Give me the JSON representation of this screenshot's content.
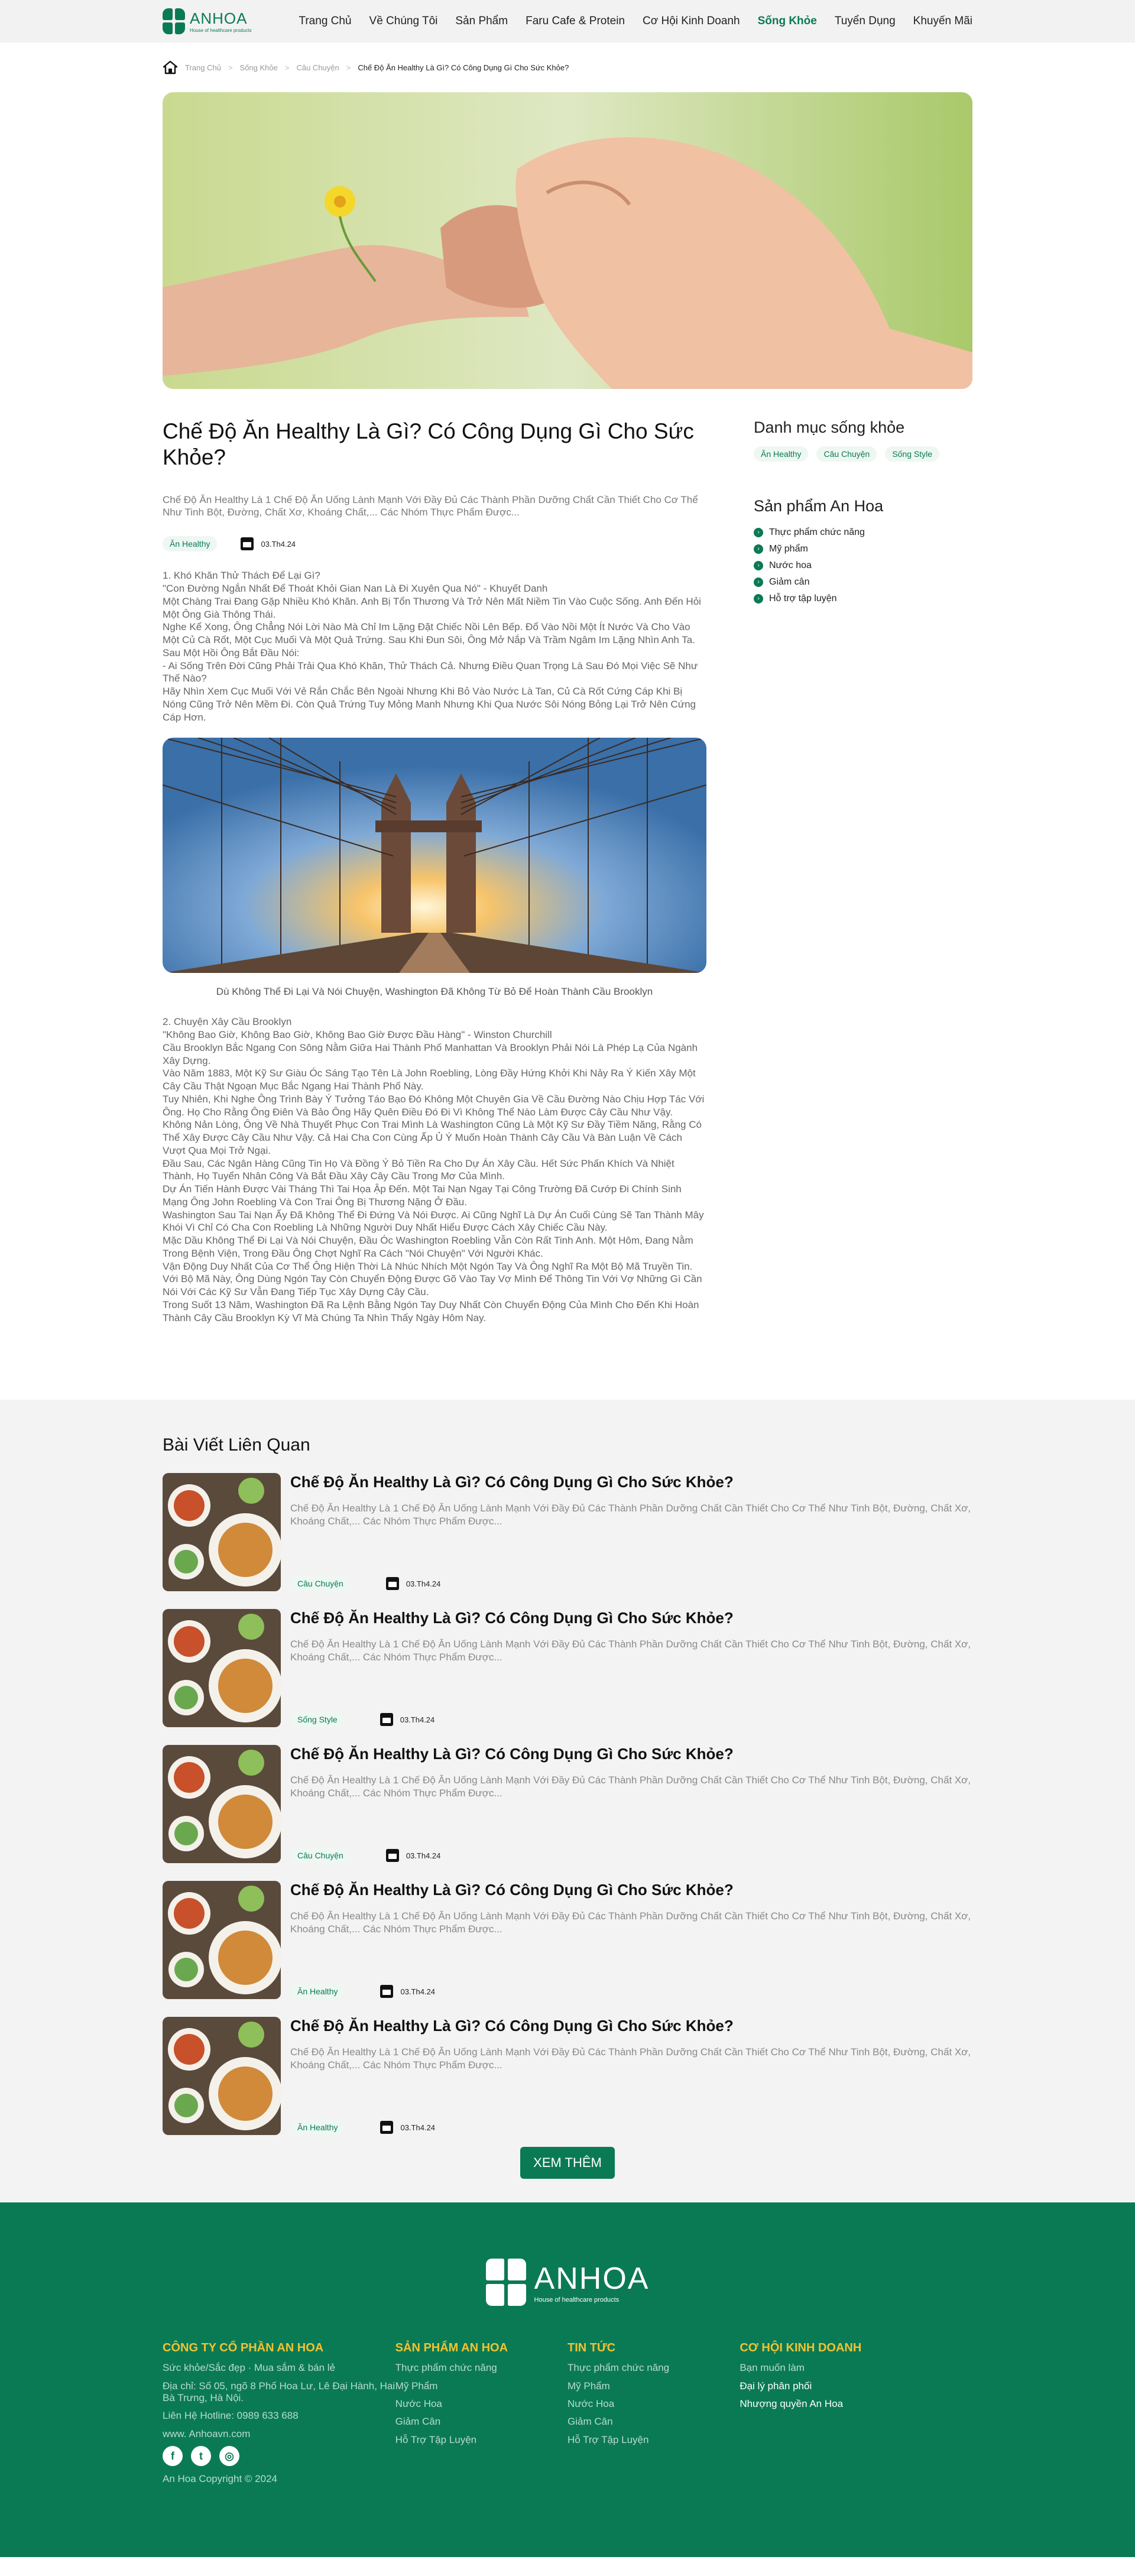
{
  "header": {
    "brand": "ANHOA",
    "brand_sub": "House of healthcare products",
    "nav": [
      "Trang Chủ",
      "Về Chúng Tôi",
      "Sản Phẩm",
      "Faru Cafe & Protein",
      "Cơ Hội Kinh Doanh",
      "Sống Khỏe",
      "Tuyển Dụng",
      "Khuyến Mãi"
    ]
  },
  "breadcrumb": [
    "Trang Chủ",
    "Sống Khỏe",
    "Câu Chuyện",
    "Chế Độ Ăn Healthy Là Gì? Có Công Dụng Gì Cho Sức Khỏe?"
  ],
  "article": {
    "title": "Chế Độ Ăn Healthy Là Gì? Có Công Dụng Gì Cho Sức Khỏe?",
    "excerpt": "Chế Độ Ăn Healthy Là 1 Chế Độ Ăn Uống Lành Mạnh Với Đầy Đủ Các Thành Phần Dưỡng Chất Cần Thiết Cho Cơ Thể Như Tinh Bột, Đường, Chất Xơ, Khoáng Chất,... Các Nhóm Thực Phẩm Được...",
    "tag": "Ăn Healthy",
    "date": "03.Th4.24",
    "section1": [
      "1. Khó Khăn Thử Thách Để Lại Gì?",
      "\"Con Đường Ngắn Nhất Để Thoát Khỏi Gian Nan Là Đi Xuyên Qua Nó\" - Khuyết Danh",
      "Một Chàng Trai Đang Gặp Nhiều Khó Khăn. Anh Bị Tổn Thương Và Trở Nên Mất Niềm Tin Vào Cuộc Sống. Anh Đến Hỏi Một Ông Già Thông Thái.",
      "Nghe Kể Xong, Ông Chẳng Nói Lời Nào Mà Chỉ Im Lặng Đặt Chiếc Nồi Lên Bếp. Đổ Vào Nồi Một Ít Nước Và Cho Vào Một Củ Cà Rốt, Một Cục Muối Và Một Quả Trứng. Sau Khi Đun Sôi, Ông Mở Nắp Và Trầm Ngâm Im Lặng Nhìn Anh Ta.",
      "Sau Một Hồi Ông Bắt Đầu Nói:",
      "- Ai Sống Trên Đời Cũng Phải Trải Qua Khó Khăn, Thử Thách Cả. Nhưng Điều Quan Trọng Là Sau Đó Mọi Việc Sẽ Như Thế Nào?",
      "Hãy Nhìn Xem Cục Muối Với Vẻ Rắn Chắc Bên Ngoài Nhưng Khi Bỏ Vào Nước Là Tan, Củ Cà Rốt Cứng Cáp Khi Bị Nóng Cũng Trở Nên Mềm Đi. Còn Quả Trứng Tuy Mỏng Manh Nhưng Khi Qua Nước Sôi Nóng Bỏng Lại Trở Nên Cứng Cáp Hơn."
    ],
    "caption": "Dù Không Thể Đi Lại Và Nói Chuyện, Washington Đã Không Từ Bỏ Để Hoàn Thành Cầu Brooklyn",
    "section2": [
      "2. Chuyện Xây Cầu Brooklyn",
      "\"Không Bao Giờ, Không Bao Giờ, Không Bao Giờ Được Đầu Hàng\" - Winston Churchill",
      "Cầu Brooklyn Bắc Ngang Con Sông Nằm Giữa Hai Thành Phố Manhattan Và Brooklyn Phải Nói Là Phép Lạ Của Ngành Xây Dựng.",
      "Vào Năm 1883, Một Kỹ Sư Giàu Óc Sáng Tạo Tên Là John Roebling, Lòng Đầy Hứng Khởi Khi Nảy Ra Ý Kiến Xây Một Cây Cầu Thật Ngoạn Mục Bắc Ngang Hai Thành Phố Này.",
      "Tuy Nhiên, Khi Nghe Ông Trình Bày Ý Tưởng Táo Bạo Đó Không Một Chuyên Gia Về Cầu Đường Nào Chịu Hợp Tác Với Ông. Họ Cho Rằng Ông Điên Và Bảo Ông Hãy Quên Điều Đó Đi Vì Không Thể Nào Làm Được Cây Cầu Như Vậy.",
      "Không Nản Lòng, Ông Về Nhà Thuyết Phục Con Trai Mình Là Washington Cũng Là Một Kỹ Sư Đầy Tiềm Năng, Rằng Có Thể Xây Được Cây Cầu Như Vậy. Cả Hai Cha Con Cùng Ấp Ủ Ý Muốn Hoàn Thành Cây Cầu Và Bàn Luận Về Cách Vượt Qua Mọi Trở Ngại.",
      "Đầu Sau, Các Ngân Hàng Cũng Tin Họ Và Đồng Ý Bỏ Tiền Ra Cho Dự Án Xây Cầu. Hết Sức Phấn Khích Và Nhiệt Thành, Họ Tuyển Nhân Công Và Bắt Đầu Xây Cây Cầu Trong Mơ Của Mình.",
      "Dự Án Tiến Hành Được Vài Tháng Thì Tai Họa Ập Đến. Một Tai Nạn Ngay Tại Công Trường Đã Cướp Đi Chính Sinh Mạng Ông John Roebling Và Con Trai Ông Bị Thương Nặng Ở Đầu.",
      "Washington Sau Tai Nạn Ấy Đã Không Thể Đi Đứng Và Nói Được. Ai Cũng Nghĩ Là Dự Án Cuối Cùng Sẽ Tan Thành Mây Khói Vì Chỉ Có Cha Con Roebling Là Những Người Duy Nhất Hiểu Được Cách Xây Chiếc Cầu Này.",
      "Mặc Dầu Không Thể Đi Lại Và Nói Chuyện, Đầu Óc Washington Roebling Vẫn Còn Rất Tinh Anh. Một Hôm, Đang Nằm Trong Bệnh Viện, Trong Đầu Ông Chợt Nghĩ Ra Cách \"Nói Chuyện\" Với Người Khác.",
      "Vận Động Duy Nhất Của Cơ Thể Ông Hiện Thời Là Nhúc Nhích Một Ngón Tay Và Ông Nghĩ Ra Một Bộ Mã Truyền Tin. Với Bộ Mã Này, Ông Dùng Ngón Tay Còn Chuyển Động Được Gõ Vào Tay Vợ Mình Để Thông Tin Với Vợ Những Gì Cần Nói Với Các Kỹ Sư Vẫn Đang Tiếp Tục Xây Dựng Cây Cầu.",
      "Trong Suốt 13 Năm, Washington Đã Ra Lệnh Bằng Ngón Tay Duy Nhất Còn Chuyển Động Của Mình Cho Đến Khi Hoàn Thành Cây Cầu Brooklyn Kỳ Vĩ Mà Chúng Ta Nhìn Thấy Ngày Hôm Nay."
    ]
  },
  "aside": {
    "cat_title": "Danh mục sống khỏe",
    "cat_tags": [
      "Ăn Healthy",
      "Câu Chuyện",
      "Sống Style"
    ],
    "prod_title": "Sản phẩm An Hoa",
    "products": [
      "Thực phẩm chức năng",
      "Mỹ phẩm",
      "Nước hoa",
      "Giảm cân",
      "Hỗ trợ tập luyện"
    ]
  },
  "related": {
    "title": "Bài Viết Liên Quan",
    "items": [
      {
        "title": "Chế Độ Ăn Healthy Là Gì? Có Công Dụng Gì Cho Sức Khỏe?",
        "excerpt": "Chế Độ Ăn Healthy Là 1 Chế Độ Ăn Uống Lành Mạnh Với Đầy Đủ Các Thành Phần Dưỡng Chất Cần Thiết Cho Cơ Thể Như Tinh Bột, Đường, Chất Xơ, Khoáng Chất,... Các Nhóm Thực Phẩm Được...",
        "tag": "Câu Chuyện",
        "date": "03.Th4.24"
      },
      {
        "title": "Chế Độ Ăn Healthy Là Gì? Có Công Dụng Gì Cho Sức Khỏe?",
        "excerpt": "Chế Độ Ăn Healthy Là 1 Chế Độ Ăn Uống Lành Mạnh Với Đầy Đủ Các Thành Phần Dưỡng Chất Cần Thiết Cho Cơ Thể Như Tinh Bột, Đường, Chất Xơ, Khoáng Chất,... Các Nhóm Thực Phẩm Được...",
        "tag": "Sống Style",
        "date": "03.Th4.24"
      },
      {
        "title": "Chế Độ Ăn Healthy Là Gì? Có Công Dụng Gì Cho Sức Khỏe?",
        "excerpt": "Chế Độ Ăn Healthy Là 1 Chế Độ Ăn Uống Lành Mạnh Với Đầy Đủ Các Thành Phần Dưỡng Chất Cần Thiết Cho Cơ Thể Như Tinh Bột, Đường, Chất Xơ, Khoáng Chất,... Các Nhóm Thực Phẩm Được...",
        "tag": "Câu Chuyện",
        "date": "03.Th4.24"
      },
      {
        "title": "Chế Độ Ăn Healthy Là Gì? Có Công Dụng Gì Cho Sức Khỏe?",
        "excerpt": "Chế Độ Ăn Healthy Là 1 Chế Độ Ăn Uống Lành Mạnh Với Đầy Đủ Các Thành Phần Dưỡng Chất Cần Thiết Cho Cơ Thể Như Tinh Bột, Đường, Chất Xơ, Khoáng Chất,... Các Nhóm Thực Phẩm Được...",
        "tag": "Ăn Healthy",
        "date": "03.Th4.24"
      },
      {
        "title": "Chế Độ Ăn Healthy Là Gì? Có Công Dụng Gì Cho Sức Khỏe?",
        "excerpt": "Chế Độ Ăn Healthy Là 1 Chế Độ Ăn Uống Lành Mạnh Với Đầy Đủ Các Thành Phần Dưỡng Chất Cần Thiết Cho Cơ Thể Như Tinh Bột, Đường, Chất Xơ, Khoáng Chất,... Các Nhóm Thực Phẩm Được...",
        "tag": "Ăn Healthy",
        "date": "03.Th4.24"
      }
    ],
    "more_label": "XEM THÊM"
  },
  "footer": {
    "brand": "ANHOA",
    "brand_sub": "House of healthcare products",
    "company": {
      "title": "CÔNG TY CỔ PHẦN AN HOA",
      "lines": [
        "Sức khỏe/Sắc đẹp · Mua sắm & bán lẻ",
        "Địa chỉ: Số 05, ngõ 8 Phố Hoa Lư, Lê Đại Hành, Hai Bà Trưng, Hà Nội.",
        "Liên Hệ Hotline: 0989 633 688",
        "www. Anhoavn.com"
      ],
      "copyright": "An Hoa Copyright © 2024"
    },
    "products": {
      "title": "SẢN PHẨM AN HOA",
      "items": [
        "Thực phẩm chức năng",
        "Mỹ Phẩm",
        "Nước Hoa",
        "Giảm Cân",
        "Hỗ Trợ Tập Luyện"
      ]
    },
    "news": {
      "title": "TIN TỨC",
      "items": [
        "Thực phẩm chức năng",
        "Mỹ Phẩm",
        "Nước Hoa",
        "Giảm Cân",
        "Hỗ Trợ Tập Luyện"
      ]
    },
    "business": {
      "title": "CƠ HỘI KINH DOANH",
      "items": [
        "Bạn muốn làm",
        "Đại lý phân phối",
        "Nhượng quyền An Hoa"
      ]
    }
  },
  "colors": {
    "brand": "#0a7a55",
    "accent": "#f1c232"
  }
}
